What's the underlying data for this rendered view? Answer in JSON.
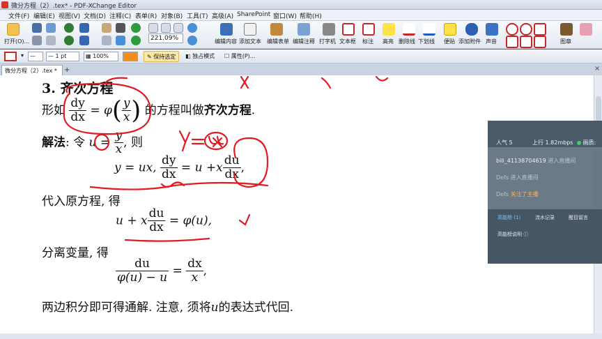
{
  "window": {
    "title": "微分方程（2）.tex* - PDF-XChange Editor"
  },
  "menu": {
    "items": [
      "文件(F)",
      "编辑(E)",
      "视图(V)",
      "文档(D)",
      "注释(C)",
      "表单(R)",
      "对象(B)",
      "工具(T)",
      "高级(A)",
      "SharePoint",
      "窗口(W)",
      "帮助(H)"
    ]
  },
  "toolbar": {
    "open_label": "打开(O)...",
    "zoom_value": "221.09%",
    "tools": [
      {
        "label": "编辑内容"
      },
      {
        "label": "添加文本"
      },
      {
        "label": "编辑表单"
      },
      {
        "label": "编辑注释"
      },
      {
        "label": "打字机"
      },
      {
        "label": "文本框"
      },
      {
        "label": "标注"
      },
      {
        "label": "高亮"
      },
      {
        "label": "删除线"
      },
      {
        "label": "下划线"
      },
      {
        "label": "便贴"
      },
      {
        "label": "添加附件"
      },
      {
        "label": "声音"
      },
      {
        "label": "图章"
      }
    ]
  },
  "toolbar2": {
    "line_width": "1 pt",
    "opacity": "100%",
    "keep_selected": "保持选定",
    "exclusive_mode": "独占模式",
    "properties": "属性(P)..."
  },
  "tab": {
    "label": "微分方程（2）.tex *",
    "add": "+",
    "close": "×"
  },
  "document": {
    "section_title": "3.  齐次方程",
    "line1_prefix": "形如",
    "line1_suffix": "的方程叫做",
    "line1_term": "齐次方程",
    "line1_end": ".",
    "method_label": "解法",
    "method_text": ": 令",
    "method_then": ", 则",
    "line3_mid": "y = ux,",
    "line3_eq": "= u +",
    "line4": "代入原方程, 得",
    "eq2_left": "u + ",
    "eq2_right": "= φ(u),",
    "line5": "分离变量, 得",
    "eq3_num_left": "du",
    "eq3_den_left": "φ(u) − u",
    "eq3_num_right": "dx",
    "eq3_den_right": "x",
    "line6_a": "两边积分即可得通解. 注意, 须将",
    "line6_var": "u",
    "line6_b": "的表达式代回."
  },
  "math_symbols": {
    "dy": "dy",
    "dx": "dx",
    "du": "du",
    "eq": "=",
    "phi": "φ",
    "y": "y",
    "x": "x",
    "u": "u",
    "comma": ","
  },
  "annotation": {
    "handwritten": "y=ux",
    "ink_color": "#e01b24"
  },
  "stream_panel": {
    "popularity_label": "人气",
    "popularity_value": "5",
    "upload_label": "上行",
    "upload_value": "1.82mbps",
    "quality_label": "画质:",
    "messages": [
      {
        "user": "bili_41138704619",
        "text": "进入直播间"
      },
      {
        "user": "Defs",
        "text": "进入直播间"
      },
      {
        "user": "Defs",
        "text": "关注了主播"
      }
    ],
    "tabs": [
      "高能榜 (1)",
      "流水记录",
      "醒目留言"
    ],
    "help": "高能榜说明"
  }
}
